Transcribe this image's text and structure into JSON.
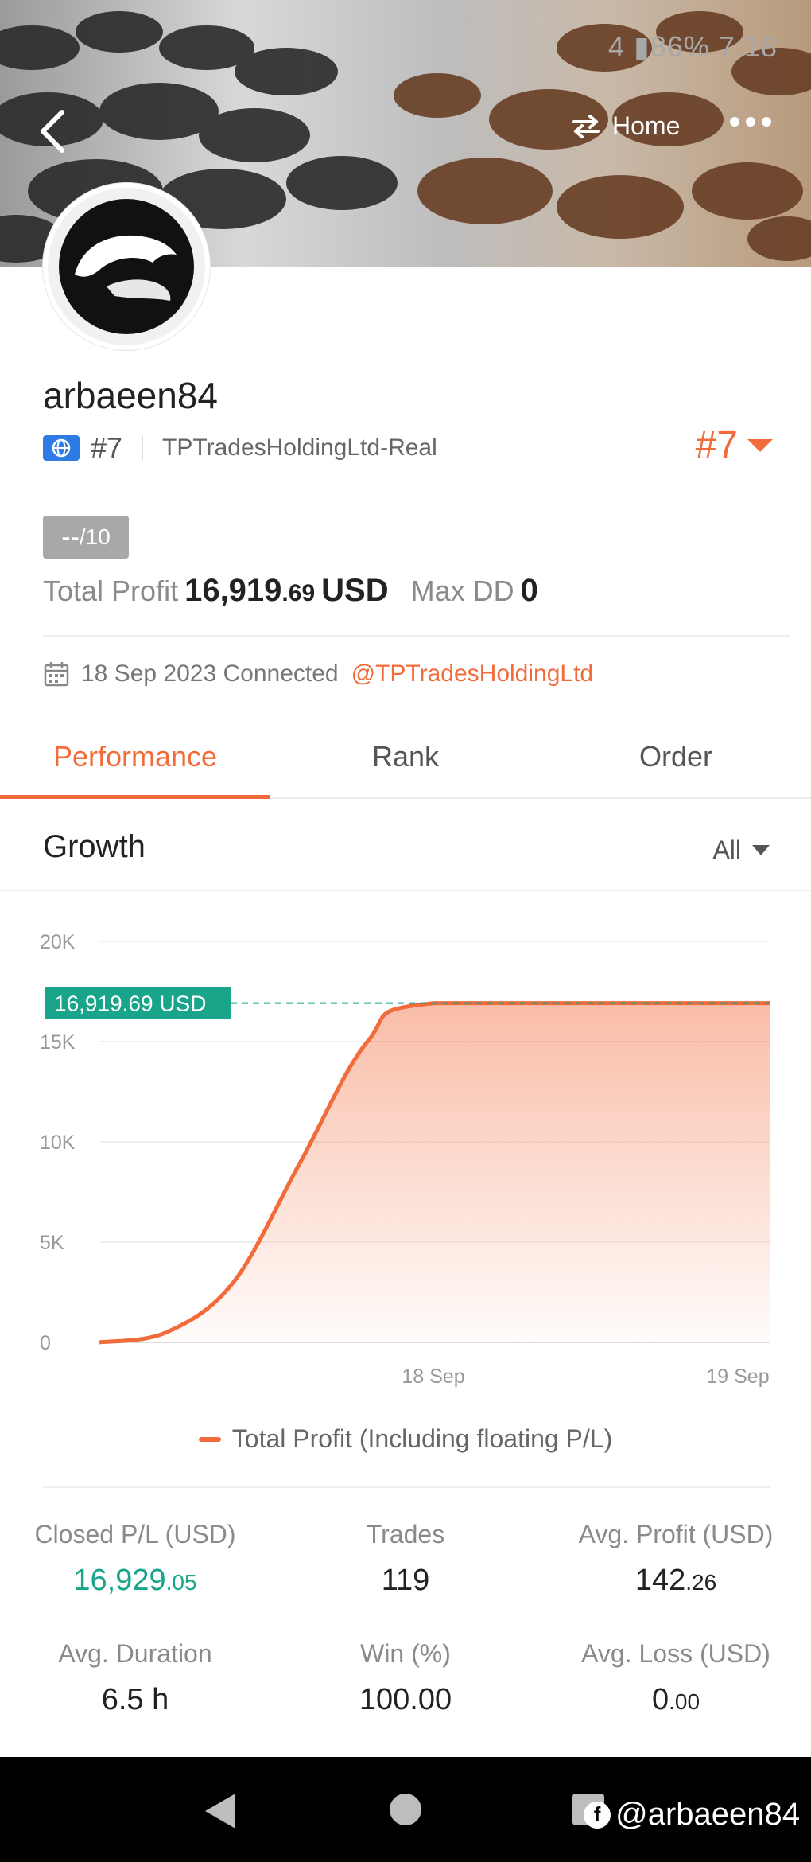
{
  "status_bar": {
    "text": "4 ▮86% 7:18"
  },
  "header": {
    "home_label": "Home"
  },
  "profile": {
    "username": "arbaeen84",
    "rank": "#7",
    "broker": "TPTradesHoldingLtd-Real",
    "rank_right": "#7",
    "score": "--",
    "score_max": "/10",
    "total_profit_label": "Total Profit",
    "total_profit_main": "16,919",
    "total_profit_cents": ".69",
    "total_profit_unit": "USD",
    "max_dd_label": "Max DD",
    "max_dd_value": "0",
    "connected_text": "18 Sep 2023 Connected",
    "connected_link": "@TPTradesHoldingLtd"
  },
  "tabs": [
    {
      "label": "Performance",
      "active": true
    },
    {
      "label": "Rank",
      "active": false
    },
    {
      "label": "Order",
      "active": false
    }
  ],
  "growth": {
    "title": "Growth",
    "filter": "All"
  },
  "chart_data": {
    "type": "area",
    "title": "",
    "xlabel": "",
    "ylabel": "",
    "y_ticks": [
      "0",
      "5K",
      "10K",
      "15K",
      "20K"
    ],
    "ylim": [
      0,
      20000
    ],
    "x_ticks": [
      "18 Sep",
      "19 Sep"
    ],
    "series": [
      {
        "name": "Total Profit (Including floating P/L)",
        "points": [
          {
            "t": 0.0,
            "y": 0
          },
          {
            "t": 0.1,
            "y": 500
          },
          {
            "t": 0.2,
            "y": 3000
          },
          {
            "t": 0.3,
            "y": 9000
          },
          {
            "t": 0.4,
            "y": 15000
          },
          {
            "t": 0.5,
            "y": 16919.69
          },
          {
            "t": 1.0,
            "y": 16919.69
          }
        ]
      }
    ],
    "current_label": "16,919.69 USD",
    "current_value": 16919.69,
    "color": "#f26b3a",
    "label_color": "#18a58a"
  },
  "legend": {
    "label": "Total Profit (Including floating P/L)"
  },
  "stats": {
    "closed_pl_label": "Closed P/L (USD)",
    "closed_pl_main": "16,929",
    "closed_pl_cents": ".05",
    "trades_label": "Trades",
    "trades_value": "119",
    "avg_profit_label": "Avg. Profit (USD)",
    "avg_profit_main": "142",
    "avg_profit_cents": ".26",
    "avg_duration_label": "Avg. Duration",
    "avg_duration_value": "6.5 h",
    "win_label": "Win (%)",
    "win_value": "100.00",
    "avg_loss_label": "Avg. Loss (USD)",
    "avg_loss_main": "0",
    "avg_loss_cents": ".00"
  },
  "watermark": {
    "fb_glyph": "f",
    "handle": "@arbaeen84"
  },
  "colors": {
    "accent": "#f26b3a",
    "green": "#18a58a"
  }
}
